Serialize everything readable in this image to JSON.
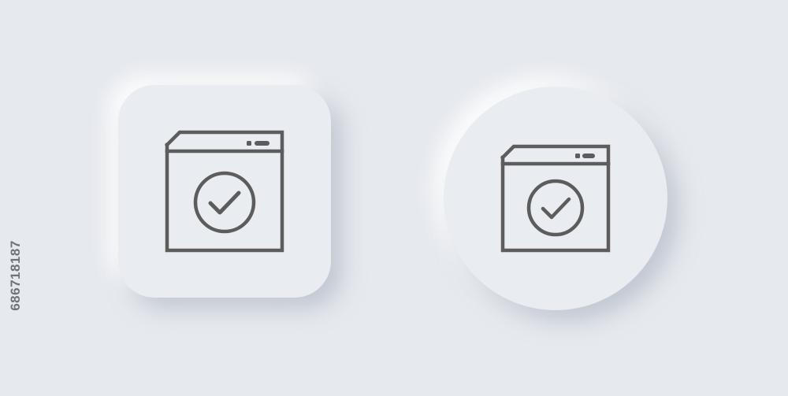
{
  "watermark": {
    "id_text": "686718187"
  },
  "icons": [
    {
      "name": "browser-check-icon",
      "container": "rounded-square"
    },
    {
      "name": "browser-check-icon",
      "container": "circle"
    }
  ],
  "colors": {
    "background": "#e6e9ee",
    "tile": "#e9ecf0",
    "stroke": "#5c5c5c"
  }
}
